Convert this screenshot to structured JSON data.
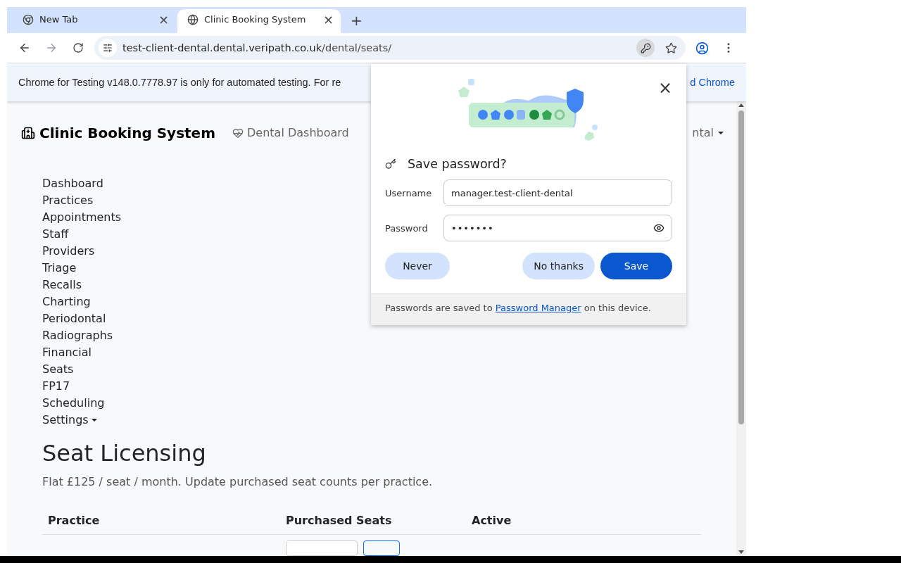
{
  "tabs": [
    {
      "title": "New Tab",
      "kind": "chrome",
      "selected": false,
      "close": "×"
    },
    {
      "title": "Clinic Booking System",
      "kind": "globe",
      "selected": true,
      "close": "×"
    }
  ],
  "new_tab": "+",
  "address_bar": {
    "host": "test-client-dental.dental.veripath.co.uk",
    "path": "/dental/seats/"
  },
  "infobar": {
    "text": "Chrome for Testing v148.0.7778.97 is only for automated testing. For re",
    "link": "d Chrome"
  },
  "navbar": {
    "brand": "Clinic Booking System",
    "link": "Dental Dashboard",
    "dropdown": "ntal"
  },
  "sidebar": {
    "items": [
      {
        "label": "Dashboard",
        "has_caret": false
      },
      {
        "label": "Practices",
        "has_caret": false
      },
      {
        "label": "Appointments",
        "has_caret": false
      },
      {
        "label": "Staff",
        "has_caret": false
      },
      {
        "label": "Providers",
        "has_caret": false
      },
      {
        "label": "Triage",
        "has_caret": false
      },
      {
        "label": "Recalls",
        "has_caret": false
      },
      {
        "label": "Charting",
        "has_caret": false
      },
      {
        "label": "Periodontal",
        "has_caret": false
      },
      {
        "label": "Radiographs",
        "has_caret": false
      },
      {
        "label": "Financial",
        "has_caret": false
      },
      {
        "label": "Seats",
        "has_caret": false
      },
      {
        "label": "FP17",
        "has_caret": false
      },
      {
        "label": "Scheduling",
        "has_caret": false
      },
      {
        "label": "Settings",
        "has_caret": true
      }
    ]
  },
  "page": {
    "title": "Seat Licensing",
    "subtitle": "Flat £125 / seat / month. Update purchased seat counts per practice."
  },
  "table": {
    "columns": [
      "Practice",
      "Purchased Seats",
      "Active"
    ]
  },
  "password_dialog": {
    "title": "Save password?",
    "close": "×",
    "fields": [
      {
        "label": "Username",
        "value": "manager.test-client-dental",
        "kind": "text"
      },
      {
        "label": "Password",
        "value": "•••••••",
        "kind": "password"
      }
    ],
    "buttons": [
      {
        "label": "Never",
        "kind": "secondary"
      },
      {
        "label": "No thanks",
        "kind": "secondary"
      },
      {
        "label": "Save",
        "kind": "primary"
      }
    ],
    "footer_before": "Passwords are saved to ",
    "footer_link": "Password Manager",
    "footer_after": " on this device."
  }
}
